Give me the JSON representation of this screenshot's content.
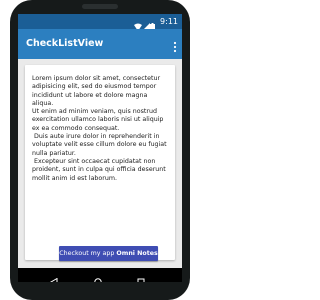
{
  "status_bar": {
    "time": "9:11",
    "icons": [
      "wifi-icon",
      "signal-icon",
      "battery-icon"
    ]
  },
  "app_bar": {
    "title": "CheckListView",
    "overflow_icon": "more-vert-icon"
  },
  "content": {
    "body_text": "Lorem ipsum dolor sit amet, consectetur adipisicing elit, sed do eiusmod tempor incididunt ut labore et dolore magna aliqua.\nUt enim ad minim veniam, quis nostrud exercitation ullamco laboris nisi ut aliquip ex ea commodo consequat.\n Duis aute irure dolor in reprehenderit in voluptate velit esse cillum dolore eu fugiat nulla pariatur.\n Excepteur sint occaecat cupidatat non proident, sunt in culpa qui officia deserunt mollit anim id est laborum.",
    "button_prefix": "Checkout my app ",
    "button_emphasis": "Omni Notes"
  },
  "nav_bar": {
    "icons": [
      "back-icon",
      "home-icon",
      "recents-icon"
    ]
  },
  "colors": {
    "status_bar": "#1b5e96",
    "app_bar": "#2c7fc0",
    "button": "#3f4db3",
    "background": "#eaeaea"
  }
}
